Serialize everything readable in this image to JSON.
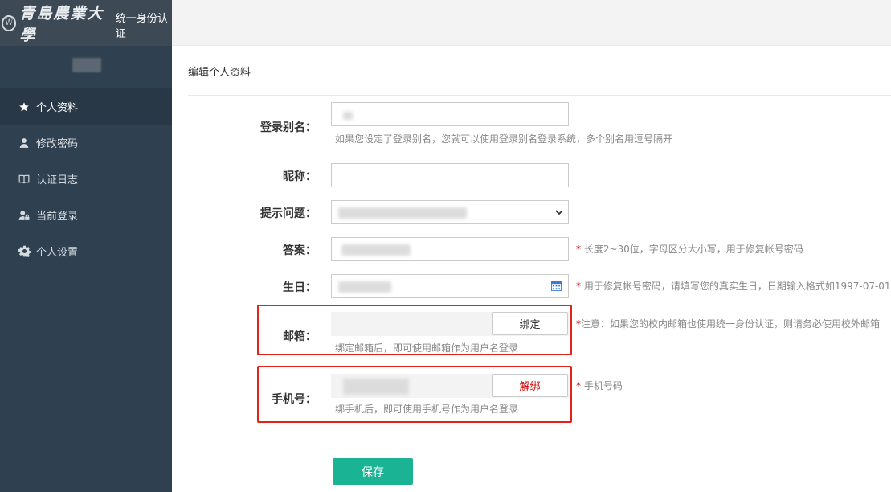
{
  "brand": {
    "name": "青島農業大學",
    "subtitle": "统一身份认证",
    "seal_icon": "university-seal-icon"
  },
  "sidebar": {
    "items": [
      {
        "label": "个人资料",
        "icon": "star-icon",
        "active": true
      },
      {
        "label": "修改密码",
        "icon": "user-icon",
        "active": false
      },
      {
        "label": "认证日志",
        "icon": "book-icon",
        "active": false
      },
      {
        "label": "当前登录",
        "icon": "user-lock-icon",
        "active": false
      },
      {
        "label": "个人设置",
        "icon": "gear-icon",
        "active": false
      }
    ]
  },
  "main": {
    "title": "编辑个人资料",
    "fields": {
      "alias": {
        "label": "登录别名：",
        "help": "如果您设定了登录别名，您就可以使用登录别名登录系统，多个别名用逗号隔开"
      },
      "nickname": {
        "label": "昵称："
      },
      "question": {
        "label": "提示问题："
      },
      "answer": {
        "label": "答案：",
        "note": "长度2~30位，字母区分大小写，用于修复帐号密码"
      },
      "birthday": {
        "label": "生日：",
        "note": "用于修复帐号密码，请填写您的真实生日，日期输入格式如1997-07-01"
      },
      "email": {
        "label": "邮箱：",
        "button": "绑定",
        "help": "绑定邮箱后，即可使用邮箱作为用户名登录",
        "note": "注意：如果您的校内邮箱也使用统一身份认证，则请务必使用校外邮箱"
      },
      "phone": {
        "label": "手机号：",
        "button": "解绑",
        "help": "绑手机后，即可使用手机号作为用户名登录",
        "note": "手机号码"
      }
    },
    "note_star": "*",
    "save": "保存"
  },
  "colors": {
    "sidebar": "#2f4050",
    "active": "#293846",
    "save": "#1ab394",
    "highlight": "#e2231a"
  }
}
